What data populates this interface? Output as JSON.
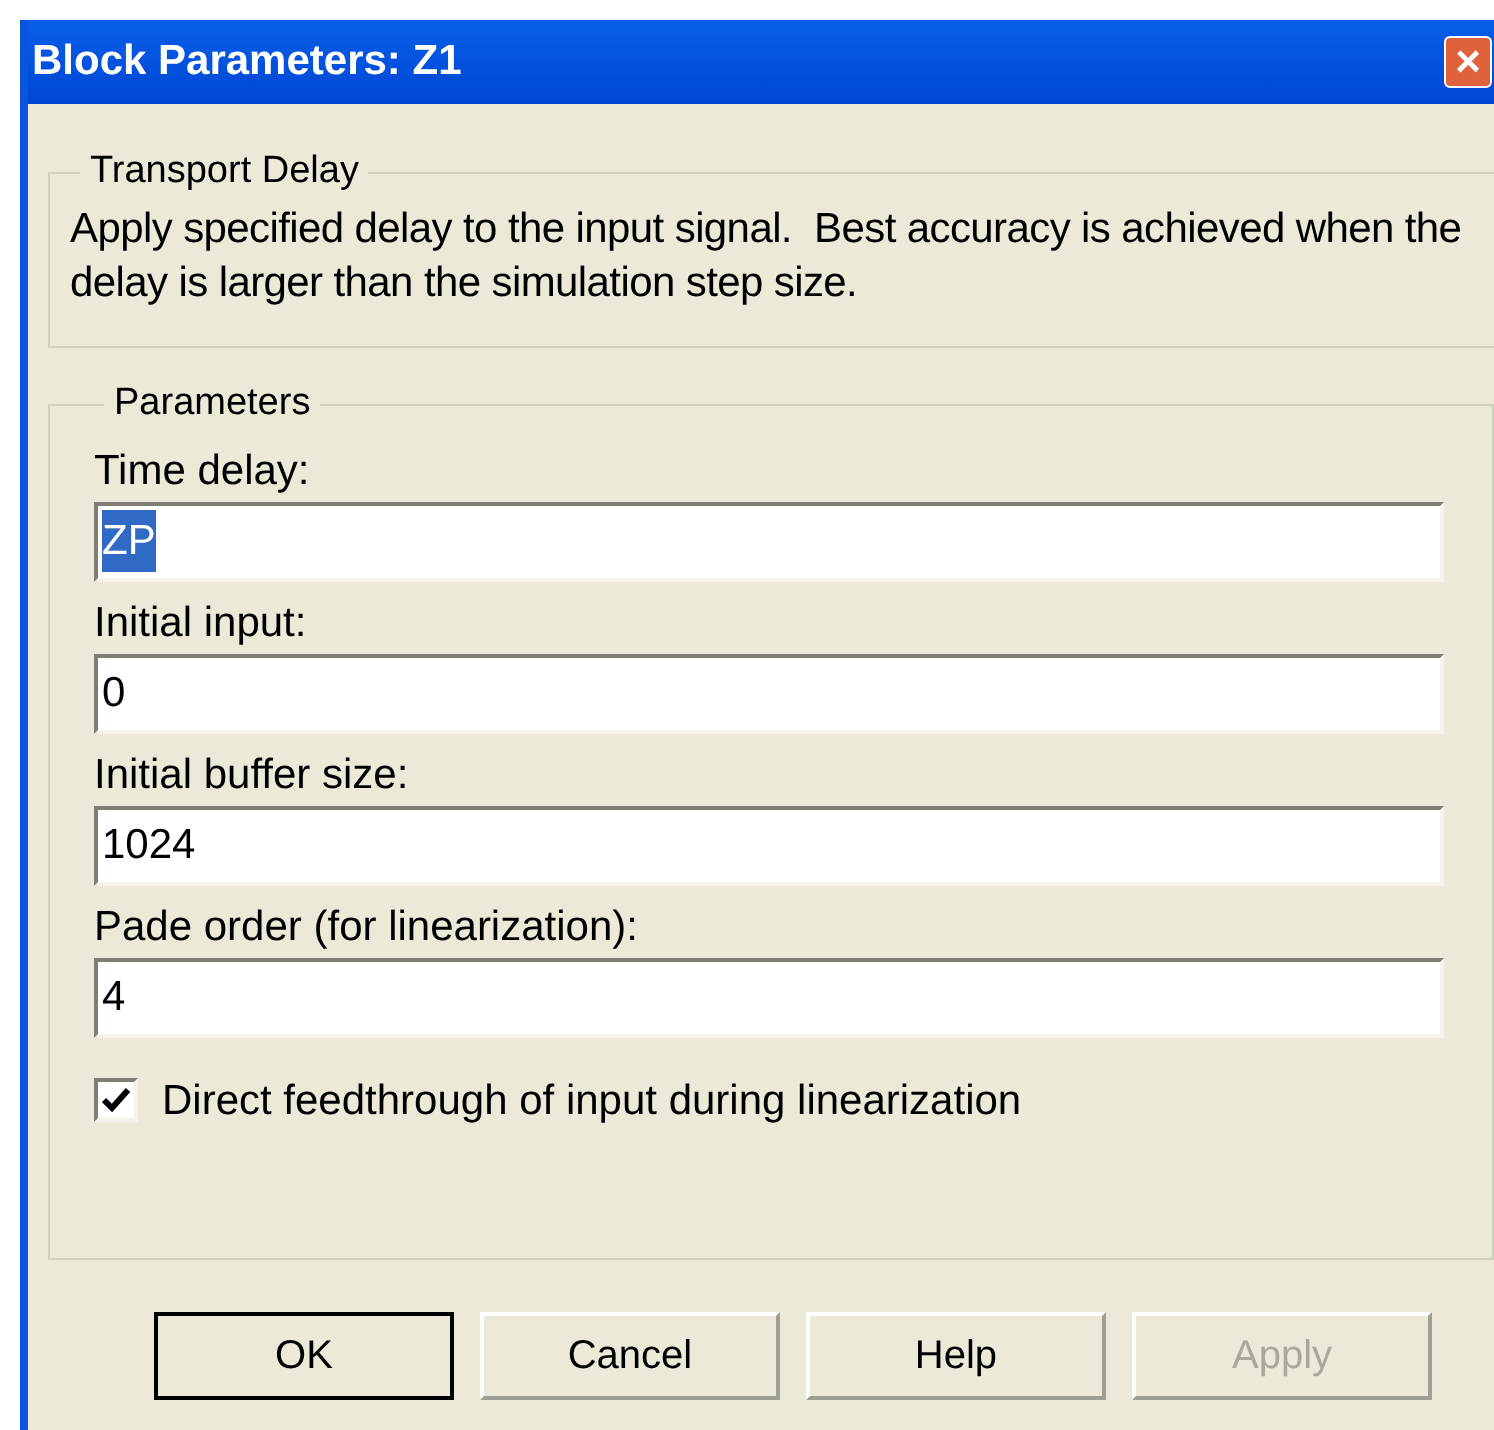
{
  "window": {
    "title": "Block Parameters: Z1",
    "close": "×"
  },
  "description": {
    "title": "Transport Delay",
    "text": "Apply specified delay to the input signal.  Best accuracy is achieved when the delay is larger than the simulation step size."
  },
  "parameters": {
    "title": "Parameters",
    "fields": [
      {
        "label": "Time delay:",
        "value": "ZP",
        "selected": true
      },
      {
        "label": "Initial input:",
        "value": "0",
        "selected": false
      },
      {
        "label": "Initial buffer size:",
        "value": "1024",
        "selected": false
      },
      {
        "label": "Pade order (for linearization):",
        "value": "4",
        "selected": false
      }
    ],
    "checkbox": {
      "label": "Direct feedthrough of input during linearization",
      "checked": true
    }
  },
  "buttons": [
    {
      "label": "OK",
      "default": true,
      "disabled": false
    },
    {
      "label": "Cancel",
      "default": false,
      "disabled": false
    },
    {
      "label": "Help",
      "default": false,
      "disabled": false
    },
    {
      "label": "Apply",
      "default": false,
      "disabled": true
    }
  ]
}
